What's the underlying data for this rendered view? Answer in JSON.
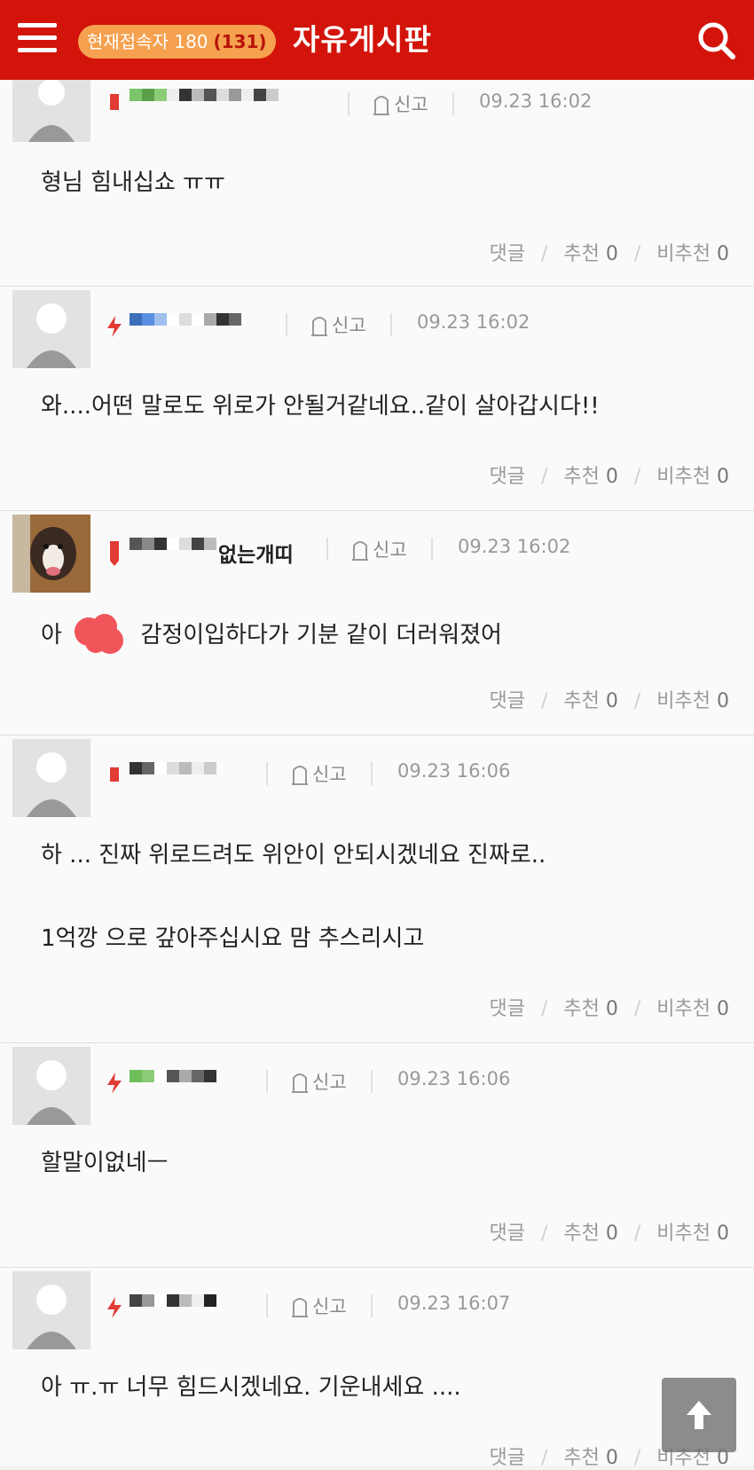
{
  "header": {
    "online_label": "현재접속자 180",
    "online_count": "(131)",
    "title": "자유게시판"
  },
  "labels": {
    "report": "신고",
    "reply": "댓글",
    "recommend": "추천",
    "not_recommend": "비추천"
  },
  "comments": [
    {
      "nickname": "",
      "time": "09.23 16:02",
      "text": "형님 힘내십쇼 ㅠㅠ",
      "recommend": "0",
      "not_recommend": "0"
    },
    {
      "nickname": "",
      "time": "09.23 16:02",
      "text": "와....어떤 말로도 위로가 안될거같네요..같이 살아갑시다!!",
      "recommend": "0",
      "not_recommend": "0"
    },
    {
      "nickname": "없는개띠",
      "time": "09.23 16:02",
      "text_prefix": "아",
      "text": "감정이입하다가 기분 같이 더러워졌어",
      "recommend": "0",
      "not_recommend": "0"
    },
    {
      "nickname": "",
      "time": "09.23 16:06",
      "text": "하 ... 진짜 위로드려도 위안이 안되시겠네요 진짜로..",
      "text2": "1억깡 으로 갚아주십시요 맘 추스리시고",
      "recommend": "0",
      "not_recommend": "0"
    },
    {
      "nickname": "",
      "time": "09.23 16:06",
      "text": "할말이없네ㅡ",
      "recommend": "0",
      "not_recommend": "0"
    },
    {
      "nickname": "",
      "time": "09.23 16:07",
      "text": "아 ㅠ.ㅠ 너무 힘드시겠네요. 기운내세요 ....",
      "recommend": "0",
      "not_recommend": "0"
    }
  ],
  "colors": {
    "header": "#d2140a",
    "pill": "#f5a14f",
    "level_icon": "#e23a34",
    "mosaic_green": "#6fbf5a"
  }
}
